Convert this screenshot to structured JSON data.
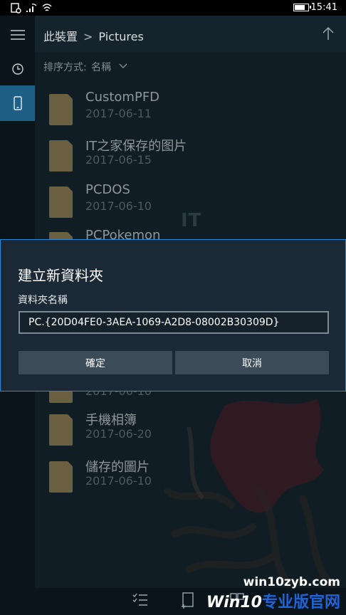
{
  "status_bar": {
    "time": "15:41",
    "battery_level": 0.85,
    "icons": [
      "app-notification-icon",
      "wifi-signal-icon",
      "wifi-icon",
      "battery-icon"
    ]
  },
  "rail": {
    "items": [
      {
        "icon": "hamburger-menu-icon"
      },
      {
        "icon": "recent-clock-icon"
      },
      {
        "icon": "device-phone-icon",
        "active": true
      }
    ]
  },
  "header": {
    "location": "此裝置",
    "separator": ">",
    "folder": "Pictures",
    "up_icon": "arrow-up-icon"
  },
  "sort": {
    "label": "排序方式:",
    "value": "名稱"
  },
  "files": [
    {
      "name": "CustomPFD",
      "date": "2017-06-11"
    },
    {
      "name": "IT之家保存的图片",
      "date": "2017-06-15"
    },
    {
      "name": "PCDOS",
      "date": "2017-06-10"
    },
    {
      "name": "PCPokemon",
      "date": ""
    },
    {
      "name": "",
      "date": "2017-06-10"
    },
    {
      "name": "手機相簿",
      "date": "2017-06-20"
    },
    {
      "name": "儲存的圖片",
      "date": "2017-06-10"
    }
  ],
  "watermark": {
    "it_text": "IT"
  },
  "dialog": {
    "title": "建立新資料夾",
    "label": "資料夾名稱",
    "input_value": "PC.{20D04FE0-3AEA-1069-A2D8-08002B30309D}",
    "confirm": "確定",
    "cancel": "取消"
  },
  "brand": {
    "url": "win10zyb.com",
    "logo_text": "Win10",
    "logo_cn": "专业版官网"
  },
  "colors": {
    "accent": "#2a8ad8",
    "folder": "#6a6041",
    "rail_active": "#1f5f86",
    "background": "#101d25"
  }
}
